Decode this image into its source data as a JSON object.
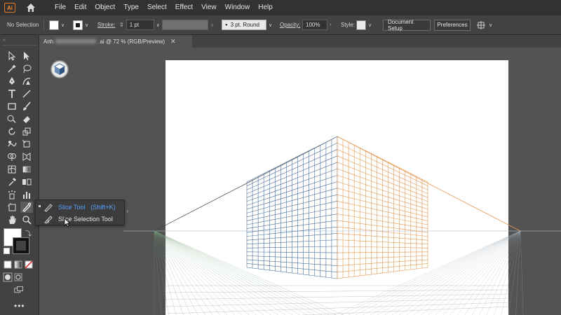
{
  "app": {
    "logo_text": "Ai",
    "home_icon": "home-icon"
  },
  "menu": [
    "File",
    "Edit",
    "Object",
    "Type",
    "Select",
    "Effect",
    "View",
    "Window",
    "Help"
  ],
  "control_bar": {
    "selection_label": "No Selection",
    "stroke_label": "Stroke:",
    "stroke_value": "1 pt",
    "brush_value": "3 pt. Round",
    "opacity_label": "Opacity:",
    "opacity_value": "100%",
    "style_label": "Style:",
    "document_setup": "Document Setup",
    "preferences": "Preferences"
  },
  "document_tab": {
    "name_prefix": "Anh",
    "name_suffix": ".ai @ 72 % (RGB/Preview)",
    "close": "✕"
  },
  "flyout": {
    "items": [
      {
        "label": "Slice Tool",
        "shortcut": "(Shift+K)"
      },
      {
        "label": "Slice Selection Tool"
      }
    ]
  },
  "colors": {
    "accent": "#5aa0ff",
    "grid_left": "#4a6f96",
    "grid_right": "#e3964f",
    "horizon_left": "#74a07a"
  }
}
